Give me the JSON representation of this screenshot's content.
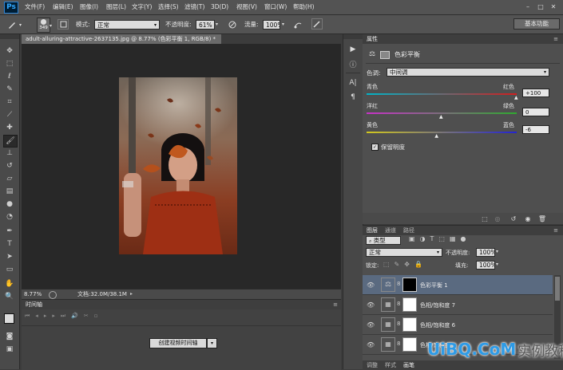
{
  "app": {
    "logo": "Ps",
    "workspace_button": "基本功能"
  },
  "menu": [
    "文件(F)",
    "编辑(E)",
    "图像(I)",
    "图层(L)",
    "文字(Y)",
    "选择(S)",
    "滤镜(T)",
    "3D(D)",
    "视图(V)",
    "窗口(W)",
    "帮助(H)"
  ],
  "options": {
    "brush_size": "349",
    "mode_label": "模式:",
    "mode_value": "正常",
    "opacity_label": "不透明度:",
    "opacity_value": "61%",
    "flow_label": "流量:",
    "flow_value": "100%"
  },
  "document": {
    "tab_title": "adult-alluring-attractive-2637135.jpg @ 8.77% (色彩平衡 1, RGB/8) *",
    "zoom": "8.77%",
    "doc_info": "文档:32.0M/38.1M"
  },
  "timeline": {
    "tab": "时间轴",
    "create_button": "创建视频时间轴"
  },
  "properties": {
    "tab": "属性",
    "title": "色彩平衡",
    "tone_label": "色调:",
    "tone_value": "中间调",
    "sliders": [
      {
        "left": "青色",
        "right": "红色",
        "value": "+100",
        "fraction": 1.0,
        "from": "#00b4c8",
        "to": "#d21e1e"
      },
      {
        "left": "洋红",
        "right": "绿色",
        "value": "0",
        "fraction": 0.5,
        "from": "#c832c8",
        "to": "#2faa2f"
      },
      {
        "left": "黄色",
        "right": "蓝色",
        "value": "-6",
        "fraction": 0.47,
        "from": "#d2c81e",
        "to": "#2323d2"
      }
    ],
    "preserve_luminosity": "保留明度"
  },
  "layers": {
    "tabs": [
      "图层",
      "通道",
      "路径"
    ],
    "filter_kind": "类型",
    "blend_mode": "正常",
    "opacity_label": "不透明度:",
    "opacity_value": "100%",
    "lock_label": "锁定:",
    "fill_label": "填充:",
    "fill_value": "100%",
    "items": [
      {
        "name": "色彩平衡 1",
        "selected": true,
        "mask": "black"
      },
      {
        "name": "色相/饱和度 7",
        "selected": false,
        "mask": "white"
      },
      {
        "name": "色相/饱和度 6",
        "selected": false,
        "mask": "white"
      },
      {
        "name": "色相/饱和度",
        "selected": false,
        "mask": "white"
      }
    ],
    "bottom_tabs": [
      "调整",
      "样式",
      "画笔"
    ]
  },
  "watermark": {
    "text": "UiBQ.CoM",
    "suffix": "实例教程"
  },
  "colors": {
    "selected_layer": "#5a6a80",
    "accent_blue": "#31a8ff"
  }
}
